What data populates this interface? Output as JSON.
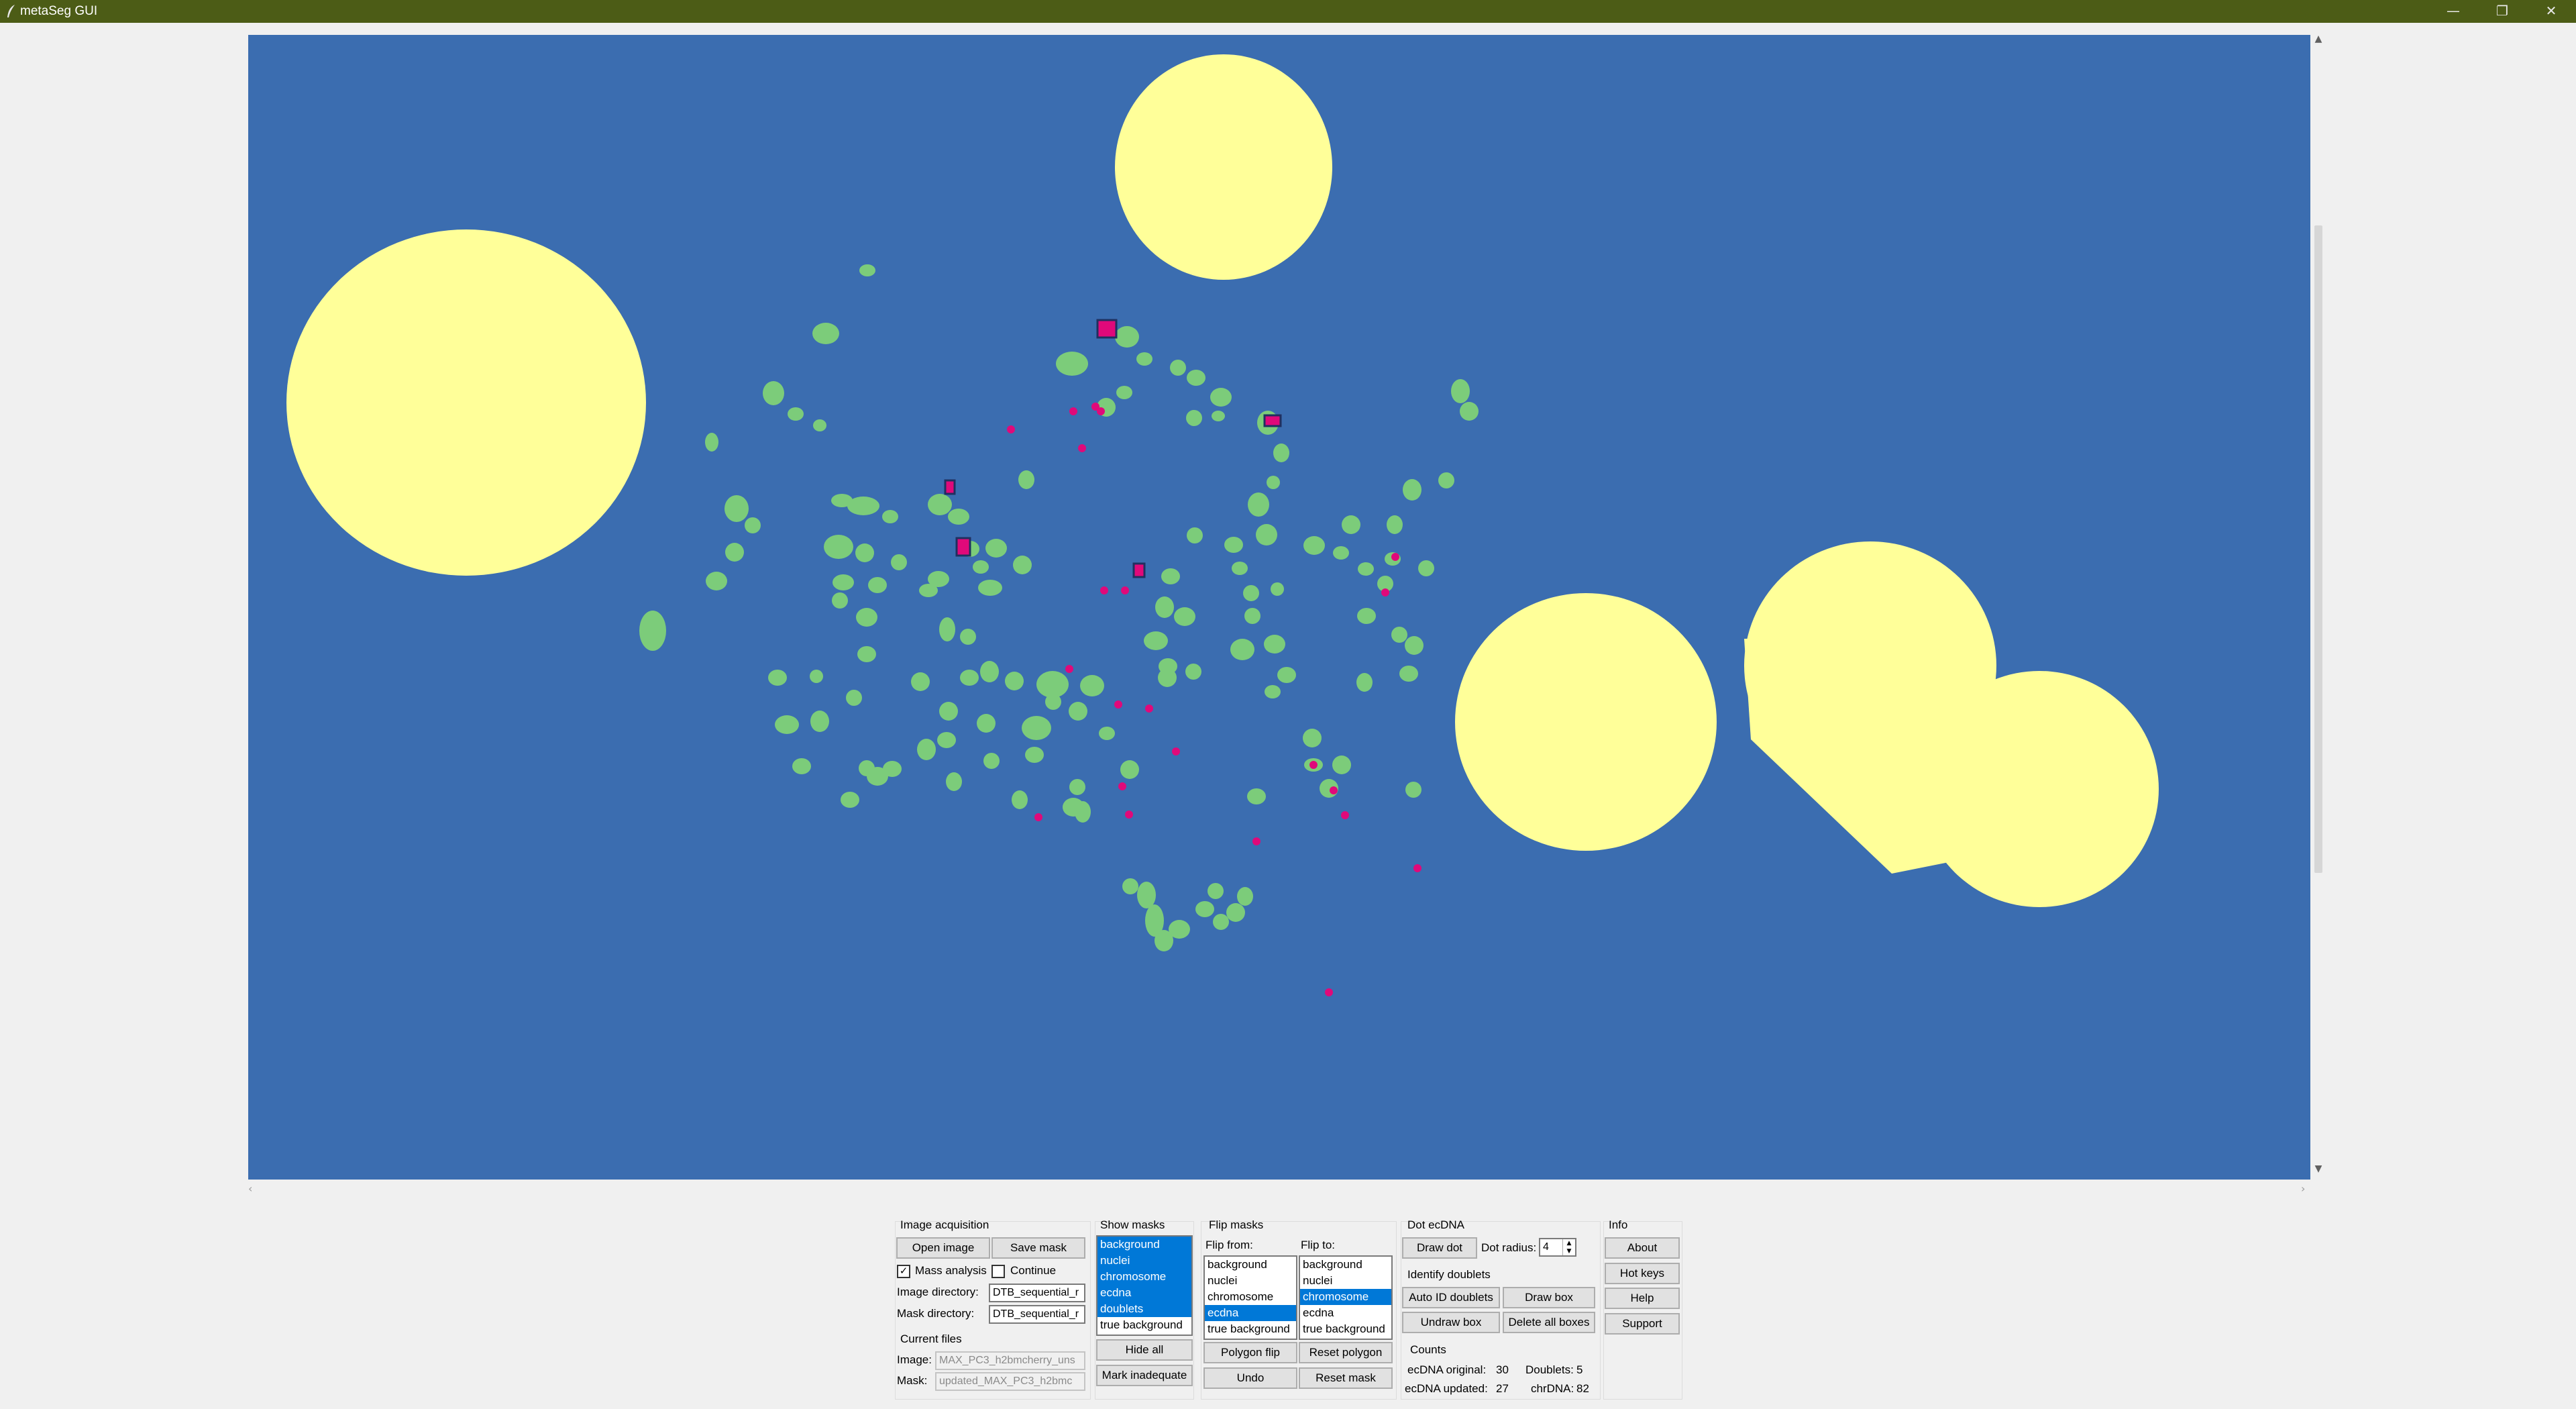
{
  "window": {
    "title": "metaSeg GUI",
    "controls": [
      "—",
      "❐",
      "✕"
    ]
  },
  "colors": {
    "background_mask": "#3b6db0",
    "nuclei_mask": "#ffff99",
    "chromosome_mask": "#7ccc7a",
    "ecdna_mask": "#e0097a",
    "selection_blue": "#0078d7"
  },
  "image_acquisition": {
    "header": "Image acquisition",
    "open_image": "Open image",
    "save_mask": "Save mask",
    "mass_analysis_label": "Mass analysis",
    "mass_analysis_checked": true,
    "continue_label": "Continue",
    "continue_checked": false,
    "image_directory_label": "Image directory:",
    "image_directory_value": "DTB_sequential_r",
    "mask_directory_label": "Mask directory:",
    "mask_directory_value": "DTB_sequential_r"
  },
  "current_files": {
    "header": "Current files",
    "image_label": "Image:",
    "image_value": "MAX_PC3_h2bmcherry_uns",
    "mask_label": "Mask:",
    "mask_value": "updated_MAX_PC3_h2bmc"
  },
  "show_masks": {
    "header": "Show masks",
    "items": [
      {
        "label": "background",
        "selected": true
      },
      {
        "label": "nuclei",
        "selected": true
      },
      {
        "label": "chromosome",
        "selected": true
      },
      {
        "label": "ecdna",
        "selected": true
      },
      {
        "label": "doublets",
        "selected": true
      },
      {
        "label": "true background",
        "selected": false
      }
    ],
    "hide_all": "Hide all",
    "mark_inadequate": "Mark inadequate"
  },
  "flip_masks": {
    "header": "Flip masks",
    "from_label": "Flip from:",
    "to_label": "Flip to:",
    "from_items": [
      {
        "label": "background",
        "selected": false
      },
      {
        "label": "nuclei",
        "selected": false
      },
      {
        "label": "chromosome",
        "selected": false
      },
      {
        "label": "ecdna",
        "selected": true
      },
      {
        "label": "true background",
        "selected": false
      }
    ],
    "to_items": [
      {
        "label": "background",
        "selected": false
      },
      {
        "label": "nuclei",
        "selected": false
      },
      {
        "label": "chromosome",
        "selected": true
      },
      {
        "label": "ecdna",
        "selected": false
      },
      {
        "label": "true background",
        "selected": false
      }
    ],
    "polygon_flip": "Polygon flip",
    "reset_polygon": "Reset polygon",
    "undo": "Undo",
    "reset_mask": "Reset mask"
  },
  "dot_ecdna": {
    "header": "Dot ecDNA",
    "draw_dot": "Draw dot",
    "dot_radius_label": "Dot radius:",
    "dot_radius_value": "4"
  },
  "identify_doublets": {
    "header": "Identify doublets",
    "auto_id": "Auto ID doublets",
    "draw_box": "Draw box",
    "undraw_box": "Undraw box",
    "delete_all_boxes": "Delete all boxes"
  },
  "counts": {
    "header": "Counts",
    "ecdna_original_label": "ecDNA original:",
    "ecdna_original": "30",
    "doublets_label": "Doublets:",
    "doublets": "5",
    "ecdna_updated_label": "ecDNA updated:",
    "ecdna_updated": "27",
    "chrdna_label": "chrDNA:",
    "chrdna": "82"
  },
  "info": {
    "header": "Info",
    "about": "About",
    "hot_keys": "Hot keys",
    "help": "Help",
    "support": "Support"
  }
}
